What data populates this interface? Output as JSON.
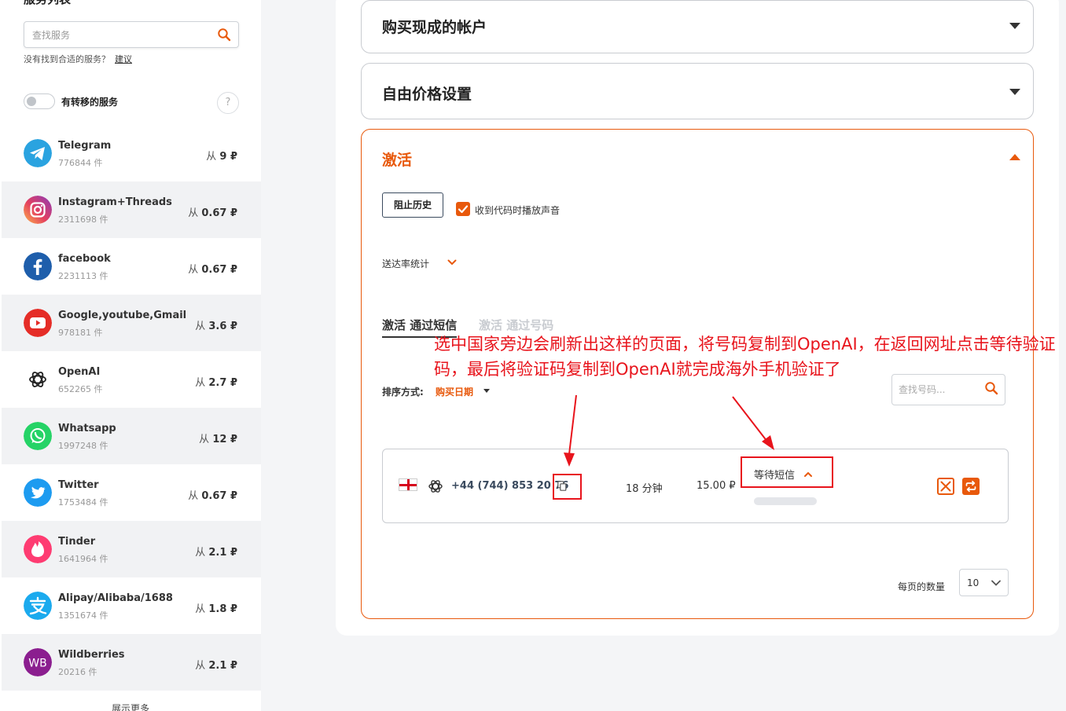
{
  "sidebar": {
    "title": "服务列表",
    "search_placeholder": "查找服务",
    "notfound_text": "没有找到合适的服务？",
    "suggest_link": "建议",
    "toggle_label": "有转移的服务",
    "help": "?",
    "services": [
      {
        "name": "Telegram",
        "count": "776844 件",
        "price_prefix": "从",
        "price": "9 ₽",
        "icon": "telegram-icon"
      },
      {
        "name": "Instagram+Threads",
        "count": "2311698 件",
        "price_prefix": "从",
        "price": "0.67 ₽",
        "icon": "instagram-icon"
      },
      {
        "name": "facebook",
        "count": "2231113 件",
        "price_prefix": "从",
        "price": "0.67 ₽",
        "icon": "facebook-icon"
      },
      {
        "name": "Google,youtube,Gmail",
        "count": "978181 件",
        "price_prefix": "从",
        "price": "3.6 ₽",
        "icon": "youtube-icon"
      },
      {
        "name": "OpenAI",
        "count": "652265 件",
        "price_prefix": "从",
        "price": "2.7 ₽",
        "icon": "openai-icon"
      },
      {
        "name": "Whatsapp",
        "count": "1997248 件",
        "price_prefix": "从",
        "price": "12 ₽",
        "icon": "whatsapp-icon"
      },
      {
        "name": "Twitter",
        "count": "1753484 件",
        "price_prefix": "从",
        "price": "0.67 ₽",
        "icon": "twitter-icon"
      },
      {
        "name": "Tinder",
        "count": "1641964 件",
        "price_prefix": "从",
        "price": "2.1 ₽",
        "icon": "tinder-icon"
      },
      {
        "name": "Alipay/Alibaba/1688",
        "count": "1351674 件",
        "price_prefix": "从",
        "price": "1.8 ₽",
        "icon": "alipay-icon"
      },
      {
        "name": "Wildberries",
        "count": "20216 件",
        "price_prefix": "从",
        "price": "2.1 ₽",
        "icon": "wildberries-icon",
        "badge": "WB"
      }
    ],
    "show_more": "展示更多"
  },
  "main": {
    "accordions": {
      "buy_accounts": "购买现成的帐户",
      "free_price": "自由价格设置",
      "activation": "激活"
    },
    "activation": {
      "history_button": "阻止历史",
      "sound_checkbox_label": "收到代码时播放声音",
      "sound_checked": true,
      "delivery_stats": "送达率统计",
      "tabs": [
        "激活 通过短信",
        "激活 通过号码"
      ],
      "sort_label": "排序方式:",
      "sort_value": "购买日期",
      "number_search_placeholder": "查找号码...",
      "rows": [
        {
          "country_flag": "england-flag",
          "service_icon": "openai-icon",
          "phone": "+44 (744) 853 20 76",
          "duration": "18 分钟",
          "price": "15.00 ₽",
          "status": "等待短信"
        }
      ],
      "per_page_label": "每页的数量",
      "per_page_value": "10"
    }
  },
  "annotation": {
    "text": "选中国家旁边会刷新出这样的页面，将号码复制到OpenAI，在返回网址点击等待验证码，最后将验证码复制到OpenAI就完成海外手机验证了",
    "color": "#e8141c"
  },
  "colors": {
    "accent": "#e8590c",
    "annotation": "#e8141c"
  }
}
